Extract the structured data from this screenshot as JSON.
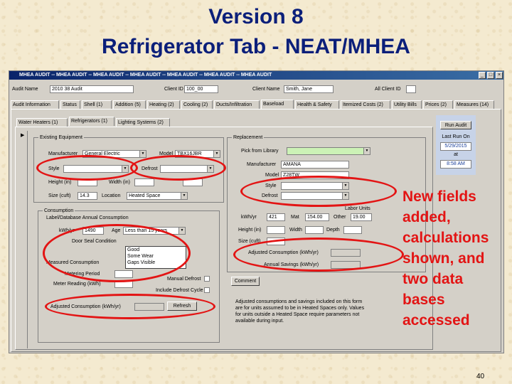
{
  "slide": {
    "title_line1": "Version 8",
    "title_line2": "Refrigerator Tab - NEAT/MHEA",
    "callout": "New fields added, calculations shown, and two data bases accessed",
    "page_number": "40"
  },
  "window": {
    "title": "MHEA AUDIT -- MHEA AUDIT -- MHEA AUDIT -- MHEA AUDIT -- MHEA AUDIT -- MHEA AUDIT -- MHEA AUDIT",
    "min_btn": "_",
    "max_btn": "□",
    "close_btn": "×"
  },
  "header": {
    "audit_name_label": "Audit Name",
    "audit_name_value": "2010  38 Audit",
    "client_id_label": "Client ID",
    "client_id_value": "100_00",
    "client_name_label": "Client Name",
    "client_name_value": "Smith, Jane",
    "all_client_label": "All Client ID"
  },
  "main_tabs": [
    "Audit Information",
    "Status",
    "Shell (1)",
    "Addition (5)",
    "Heating (2)",
    "Cooling (2)",
    "Ducts/Infiltration",
    "Baseload",
    "Health & Safety",
    "Itemized Costs (2)",
    "Utility Bills",
    "Prices (2)",
    "Measures (14)"
  ],
  "sub_tabs": [
    "Water Heaters (1)",
    "Refrigerators (1)",
    "Lighting Systems (2)"
  ],
  "existing": {
    "group_title": "Existing Equipment",
    "manufacturer_label": "Manufacturer",
    "manufacturer_value": "General Electric",
    "model_label": "Model",
    "model_value": "TBX16JBR",
    "style_label": "Style",
    "defrost_label": "Defrost",
    "height_label": "Height (in)",
    "width_label": "Width (in)",
    "size_label": "Size (cuft)",
    "size_value": "14.3",
    "location_label": "Location",
    "location_value": "Heated Space"
  },
  "consumption": {
    "group_title": "Consumption",
    "label_db_title": "Label/Database Annual Consumption",
    "kwh_label": "kWh/yr",
    "kwh_value": "1490",
    "age_label": "Age",
    "age_value": "Less than 15 years",
    "door_seal_label": "Door Seal Condition",
    "door_seal_options": [
      "Good",
      "Some Wear",
      "Gaps Visible"
    ],
    "measured_label": "Measured Consumption",
    "metering_label": "Metering Period",
    "meter_reading_label": "Meter Reading (kWh)",
    "manual_defrost_label": "Manual Defrost",
    "defrost_cycle_label": "Include Defrost Cycle",
    "adjusted_label": "Adjusted Consumption (kWh/yr)",
    "refresh_button": "Refresh"
  },
  "replacement": {
    "group_title": "Replacement",
    "pick_label": "Pick from Library",
    "manufacturer_label": "Manufacturer",
    "manufacturer_value": "AMANA",
    "model_label": "Model",
    "model_value": "Z28TW",
    "style_label": "Style",
    "defrost_label": "Defrost",
    "kwh_label": "kWh/yr",
    "kwh_value": "421",
    "mat_label": "Mat",
    "mat_value": "154.00",
    "other_label": "Other",
    "other_value": "19.00",
    "labor_label": "Labor Units",
    "height_label": "Height (in)",
    "width_label": "Width",
    "depth_label": "Depth",
    "size_label": "Size (cuft)",
    "adjusted_label": "Adjusted Consumption (kWh/yr)",
    "savings_label": "Annual Savings (kWh/yr)",
    "comment_button": "Comment",
    "note": "Adjusted consumptions and savings included on this form are for units assumed to be in Heated Spaces only. Values for units outside a Heated Space require parameters not available during input."
  },
  "run": {
    "button": "Run Audit",
    "last_run_label": "Last Run On",
    "date": "5/29/2015",
    "at_label": "at",
    "time": "8:58 AM"
  },
  "colors": {
    "title": "#0b1f7a",
    "callout": "#e31414",
    "window_bg": "#d4d0c8",
    "highlight_field": "#ccf2b6"
  }
}
